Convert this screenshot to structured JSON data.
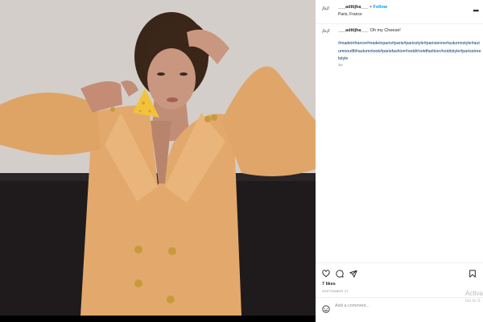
{
  "post": {
    "username": "___aditijha___",
    "follow_label": "Follow",
    "location": "Paris, France",
    "avatar_text": "ꞵᴀꞵ",
    "more_icon": "more-horizontal-icon",
    "caption_text": "Oh my Cheese!",
    "hashtags": "#madeinfrance#madeinparis#paris#parisstyle#parisienne#autumnstyle#autumnoutfit#autumnlook#parisfashion#ootd#ootdfashion#ootdstyle#parisstreetstyle",
    "time_ago": "3w",
    "likes": "7 likes",
    "date": "SEPTEMBER 27",
    "comment_placeholder": "Add a comment...",
    "icons": [
      "heart-icon",
      "comment-icon",
      "share-icon",
      "bookmark-icon",
      "emoji-icon"
    ]
  },
  "watermark": {
    "line1": "Activa",
    "line2": "Go to S"
  },
  "colors": {
    "link_blue": "#0095f6",
    "hashtag_blue": "#00376b",
    "jacket": "#e5ac6e",
    "cheese": "#f2c23b",
    "backdrop": "#cfc9c4",
    "sofa": "#1e1a1b"
  }
}
